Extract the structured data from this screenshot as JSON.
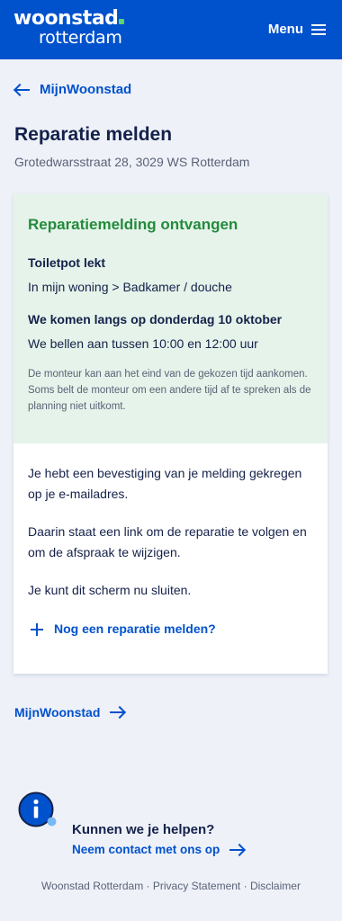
{
  "header": {
    "logo_top": "woonstad",
    "logo_bottom": "rotterdam",
    "menu_label": "Menu",
    "brand_color": "#0051cc",
    "logo_dot_color": "#5fd36a"
  },
  "back_link": {
    "label": "MijnWoonstad",
    "icon": "arrow-left-icon"
  },
  "page": {
    "title": "Reparatie melden",
    "address": "Grotedwarsstraat 28, 3029 WS Rotterdam"
  },
  "confirmation": {
    "title": "Reparatiemelding ontvangen",
    "repair_name": "Toiletpot lekt",
    "repair_location": "In mijn woning > Badkamer / douche",
    "visit_day": "We komen langs op donderdag 10 oktober",
    "call_window": "We bellen aan tussen 10:00 en 12:00 uur",
    "note": "De monteur kan aan het eind van de gekozen tijd aankomen. Soms belt de monteur om een andere tijd af te spreken als de planning niet uitkomt.",
    "success_color": "#238b3c",
    "background_color": "#e6f3ea"
  },
  "info": {
    "paragraph_1": "Je hebt een bevestiging van je melding gekregen op je e-mailadres.",
    "paragraph_2": "Daarin staat een link om de reparatie te volgen en om de afspraak te wijzigen.",
    "paragraph_3": "Je kunt dit scherm nu sluiten.",
    "add_link": "Nog een reparatie melden?"
  },
  "mijn_link": {
    "label": "MijnWoonstad",
    "icon": "arrow-right-icon"
  },
  "help": {
    "icon": "info-icon",
    "title": "Kunnen we je helpen?",
    "contact_label": "Neem contact met ons op"
  },
  "footer": {
    "company": "Woonstad Rotterdam",
    "separator": " · ",
    "privacy": "Privacy Statement",
    "disclaimer": "Disclaimer"
  }
}
